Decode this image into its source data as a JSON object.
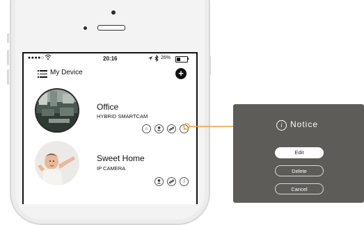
{
  "status_bar": {
    "signal": "●●●●○",
    "time": "20:16",
    "battery_text": "26%"
  },
  "header": {
    "title": "My Device",
    "add_label": "+"
  },
  "devices": [
    {
      "name": "Office",
      "type": "HYBRID SMARTCAM"
    },
    {
      "name": "Sweet Home",
      "type": "IP CAMERA"
    }
  ],
  "dialog": {
    "title": "Notice",
    "info_glyph": "i",
    "buttons": [
      "Edit",
      "Delete",
      "Cancel"
    ]
  },
  "colors": {
    "connector": "#f0a040",
    "dialog_bg": "#5e5c58"
  }
}
